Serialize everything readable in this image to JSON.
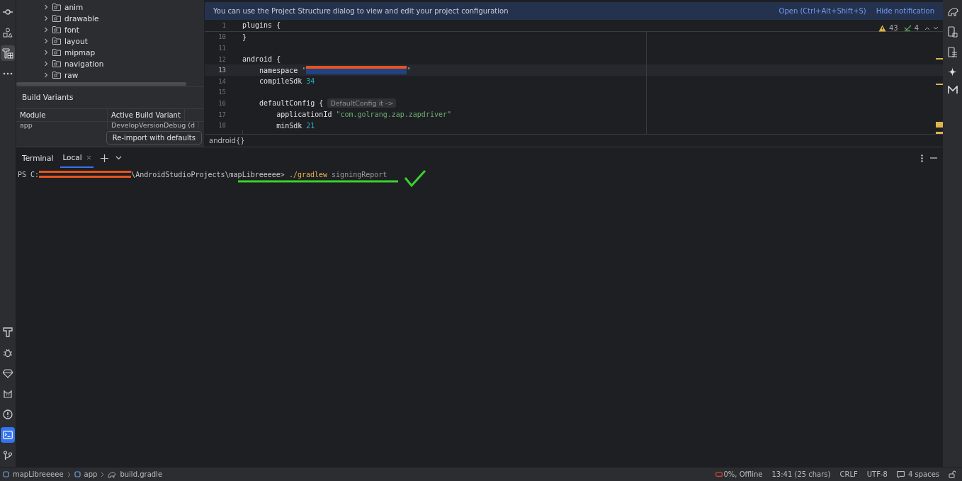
{
  "left_toolbar": {
    "top": [
      {
        "kind": "commit",
        "selected": false
      },
      {
        "kind": "shapes",
        "selected": false
      },
      {
        "kind": "build",
        "selected": true
      },
      {
        "kind": "more",
        "selected": false
      }
    ],
    "bottom": [
      {
        "kind": "hammer",
        "selected": false
      },
      {
        "kind": "bug",
        "selected": false
      },
      {
        "kind": "gem",
        "selected": false
      },
      {
        "kind": "cat",
        "selected": false
      },
      {
        "kind": "alert",
        "selected": false
      },
      {
        "kind": "terminal",
        "selected": true
      },
      {
        "kind": "git",
        "selected": false
      }
    ]
  },
  "project_tree": [
    {
      "label": "anim",
      "expanded": false
    },
    {
      "label": "drawable",
      "expanded": false
    },
    {
      "label": "font",
      "expanded": false
    },
    {
      "label": "layout",
      "expanded": false
    },
    {
      "label": "mipmap",
      "expanded": false
    },
    {
      "label": "navigation",
      "expanded": false
    },
    {
      "label": "raw",
      "expanded": false
    }
  ],
  "build_variants": {
    "title": "Build Variants",
    "columns": [
      "Module",
      "Active Build Variant"
    ],
    "rows": [
      [
        "app",
        "DevelopVersionDebug (d"
      ]
    ],
    "button": "Re-import with defaults"
  },
  "notification": {
    "text": "You can use the Project Structure dialog to view and edit your project configuration",
    "links": [
      "Open (Ctrl+Alt+Shift+S)",
      "Hide notification"
    ]
  },
  "inspections": {
    "warnings": "43",
    "typos": "4"
  },
  "editor_lines": [
    {
      "number": "1",
      "current": false,
      "tokens": [
        {
          "kind": "plain",
          "text": "plugins {"
        }
      ]
    },
    {
      "number": "10",
      "current": false,
      "tokens": [
        {
          "kind": "plain",
          "text": "}"
        }
      ]
    },
    {
      "number": "11",
      "current": false
    },
    {
      "number": "12",
      "current": false,
      "tokens": [
        {
          "kind": "plain",
          "text": "android {"
        }
      ]
    },
    {
      "number": "13",
      "current": true,
      "tokens": [
        {
          "kind": "plain",
          "text": "    namespace "
        },
        {
          "kind": "string",
          "text": "\""
        },
        {
          "kind": "redacted"
        },
        {
          "kind": "string",
          "text": "\""
        }
      ]
    },
    {
      "number": "14",
      "current": false,
      "tokens": [
        {
          "kind": "plain",
          "text": "    compileSdk "
        },
        {
          "kind": "number",
          "text": "34"
        }
      ]
    },
    {
      "number": "15",
      "current": false
    },
    {
      "number": "16",
      "current": false,
      "tokens": [
        {
          "kind": "plain",
          "text": "    defaultConfig { "
        },
        {
          "kind": "hint",
          "text": "DefaultConfig it ->"
        }
      ]
    },
    {
      "number": "17",
      "current": false,
      "tokens": [
        {
          "kind": "plain",
          "text": "        applicationId "
        },
        {
          "kind": "string",
          "text": "\"com.golrang.zap.zapdriver\""
        }
      ]
    },
    {
      "number": "18",
      "current": false,
      "tokens": [
        {
          "kind": "plain",
          "text": "        minSdk "
        },
        {
          "kind": "number",
          "text": "21"
        }
      ]
    }
  ],
  "breadcrumb": "android{}",
  "terminal": {
    "title": "Terminal",
    "tabs": [
      {
        "label": "Local",
        "selected": true
      }
    ],
    "prompt": [
      {
        "kind": "plain",
        "text": "PS C:"
      },
      {
        "kind": "redacted"
      },
      {
        "kind": "plain",
        "text": "\\AndroidStudioProjects\\mapLibreeeee> "
      },
      {
        "kind": "command",
        "text": "./gradlew"
      },
      {
        "kind": "argument",
        "text": " signingReport"
      }
    ]
  },
  "status_bar": {
    "path": [
      "mapLibreeeee",
      "app",
      "build.gradle"
    ],
    "items": [
      {
        "kind": "memory",
        "text": "0%, Offline"
      },
      {
        "kind": "text",
        "text": "13:41 (25 chars)"
      },
      {
        "kind": "text",
        "text": "CRLF"
      },
      {
        "kind": "text",
        "text": "UTF-8"
      },
      {
        "kind": "text",
        "text": "4 spaces"
      }
    ]
  }
}
